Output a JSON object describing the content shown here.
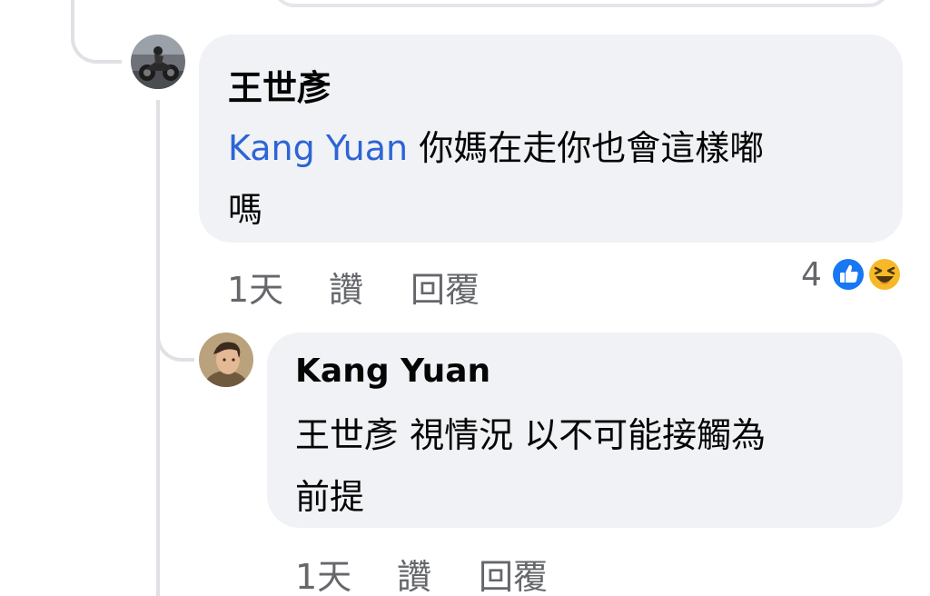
{
  "comments": [
    {
      "author": "王世彥",
      "mention": "Kang Yuan",
      "text_line1": " 你媽在走你也會這樣嘟",
      "text_line2": "嗎",
      "time": "1天",
      "like_label": "讚",
      "reply_label": "回覆",
      "reaction_count": "4",
      "reactions": [
        "like-icon",
        "haha-icon"
      ]
    },
    {
      "author": "Kang Yuan",
      "text_line1": "王世彥 視情況 以不可能接觸為",
      "text_line2": "前提",
      "time": "1天",
      "like_label": "讚",
      "reply_label": "回覆"
    }
  ],
  "colors": {
    "bubble": "#f0f2f5",
    "mention": "#2d64d6",
    "meta": "#65676b",
    "like": "#1877f2",
    "haha": "#f7b928"
  }
}
